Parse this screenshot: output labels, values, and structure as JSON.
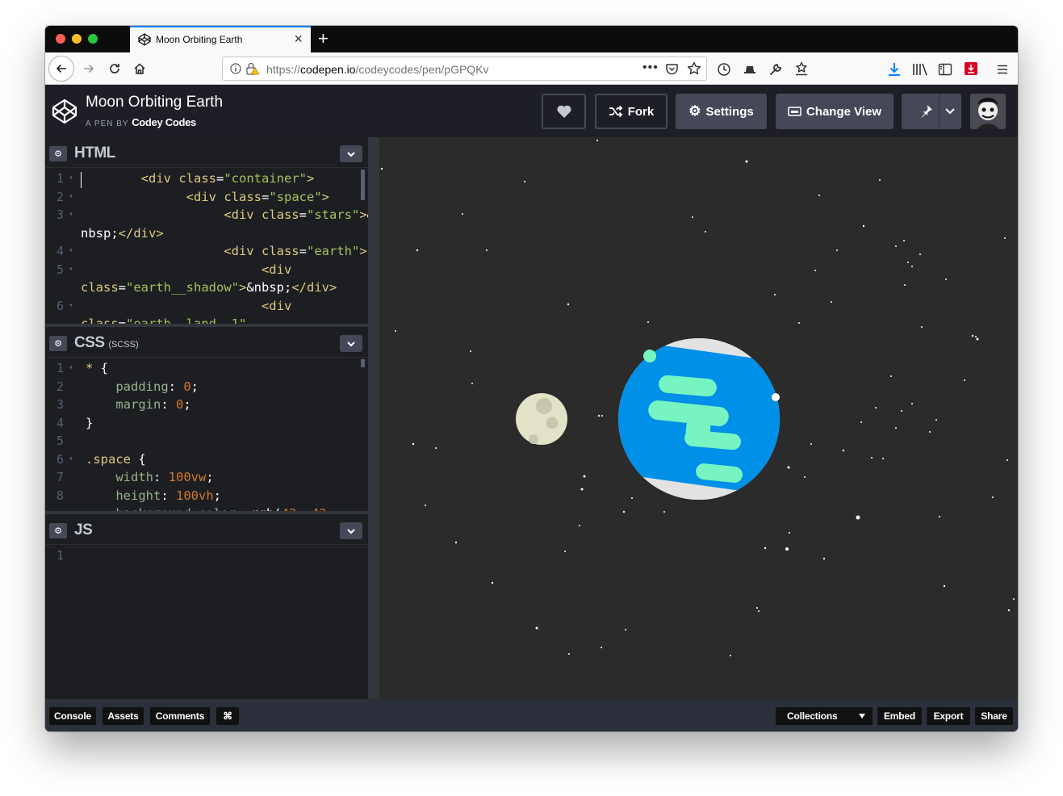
{
  "browser": {
    "tab_title": "Moon Orbiting Earth",
    "new_tab_label": "+",
    "url_prefix": "https://",
    "url_domain": "codepen.io",
    "url_path": "/codeycodes/pen/pGPQKv"
  },
  "header": {
    "pen_title": "Moon Orbiting Earth",
    "by_prefix": "A PEN BY",
    "author": "Codey Codes",
    "fork_label": "Fork",
    "settings_label": "Settings",
    "change_view_label": "Change View"
  },
  "html_panel": {
    "title": "HTML",
    "lines": [
      {
        "n": "1",
        "fold": "▾"
      },
      {
        "n": "2",
        "fold": "▾"
      },
      {
        "n": "3",
        "fold": "▾"
      },
      {
        "n": "",
        "fold": ""
      },
      {
        "n": "4",
        "fold": "▾"
      },
      {
        "n": "5",
        "fold": "▾"
      },
      {
        "n": "",
        "fold": ""
      },
      {
        "n": "6",
        "fold": "▾"
      }
    ]
  },
  "css_panel": {
    "title": "CSS",
    "subtitle": "(SCSS)",
    "line_numbers": [
      "1",
      "2",
      "3",
      "4",
      "5",
      "6",
      "7",
      "8"
    ]
  },
  "js_panel": {
    "title": "JS",
    "line_numbers": [
      "1"
    ]
  },
  "footer": {
    "console": "Console",
    "assets": "Assets",
    "comments": "Comments",
    "shortcut": "⌘",
    "collections": "Collections",
    "embed": "Embed",
    "export": "Export",
    "share": "Share"
  },
  "colors": {
    "accent": "#0a84ff",
    "codepen_bg": "#1e1f26",
    "editor_bg": "#1d1e22",
    "preview_bg": "#2b2b2b",
    "earth_blue": "#0090e8",
    "earth_land": "#76f5c2",
    "moon": "#e2e2c7"
  }
}
